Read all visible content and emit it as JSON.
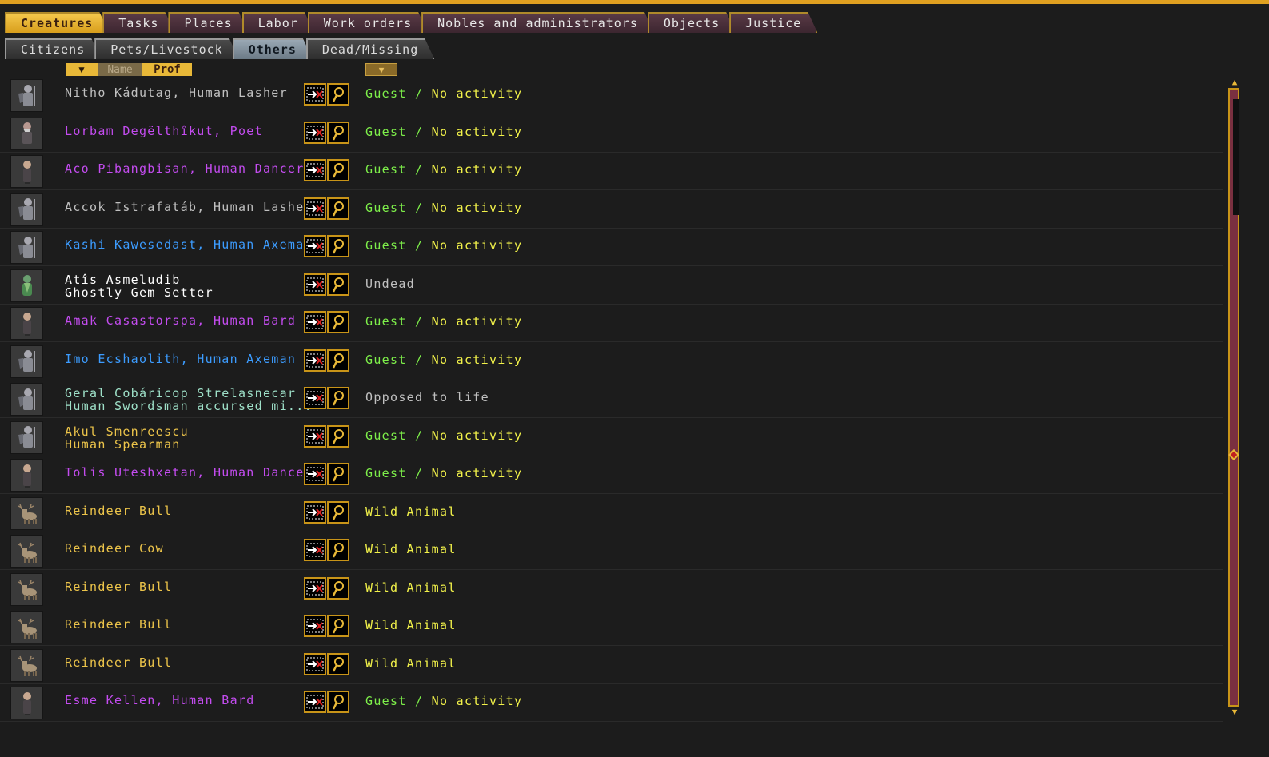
{
  "main_tabs": [
    "Creatures",
    "Tasks",
    "Places",
    "Labor",
    "Work orders",
    "Nobles and administrators",
    "Objects",
    "Justice"
  ],
  "sub_tabs": [
    "Citizens",
    "Pets/Livestock",
    "Others",
    "Dead/Missing"
  ],
  "sort": {
    "name_label": "Name",
    "prof_label": "Prof",
    "dropdown_glyph": "▼"
  },
  "colors": {
    "guest": "#7ef04a",
    "activity": "#f2f24a",
    "grey": "#c0c0c0",
    "magenta": "#c44cf0",
    "blue": "#3c9cff",
    "yellow": "#ecc44a",
    "white": "#ffffff",
    "teal": "#9ee0c8"
  },
  "rows": [
    {
      "name": "Nitho Kádutag, Human Lasher",
      "color": "grey",
      "icon": "armored-human-portrait",
      "status1": "Guest",
      "status2": "No activity",
      "scolor": "guest"
    },
    {
      "name": "Lorbam Degëlthîkut, Poet",
      "color": "magenta",
      "icon": "dwarf-portrait",
      "status1": "Guest",
      "status2": "No activity",
      "scolor": "guest"
    },
    {
      "name": "Aco Pibangbisan, Human Dancer",
      "color": "magenta",
      "icon": "human-portrait",
      "status1": "Guest",
      "status2": "No activity",
      "scolor": "guest"
    },
    {
      "name": "Accok Istrafatáb, Human Lasher",
      "color": "grey",
      "icon": "armored-human-portrait",
      "status1": "Guest",
      "status2": "No activity",
      "scolor": "guest"
    },
    {
      "name": "Kashi Kawesedast, Human Axeman",
      "color": "blue",
      "icon": "armored-human-portrait",
      "status1": "Guest",
      "status2": "No activity",
      "scolor": "guest"
    },
    {
      "name": "Atîs Asmeludib\nGhostly Gem Setter",
      "color": "white",
      "icon": "ghost-dwarf-portrait",
      "status1": "Undead",
      "status2": "",
      "scolor": "grey"
    },
    {
      "name": "Amak Casastorspa, Human Bard",
      "color": "magenta",
      "icon": "human-portrait",
      "status1": "Guest",
      "status2": "No activity",
      "scolor": "guest"
    },
    {
      "name": "Imo Ecshaolith, Human Axeman",
      "color": "blue",
      "icon": "armored-human-portrait",
      "status1": "Guest",
      "status2": "No activity",
      "scolor": "guest"
    },
    {
      "name": "Geral Cobáricop Strelasnecar\nHuman Swordsman accursed mi...",
      "color": "teal",
      "icon": "armored-human-portrait",
      "status1": "Opposed to life",
      "status2": "",
      "scolor": "grey"
    },
    {
      "name": "Akul Smenreescu\nHuman Spearman",
      "color": "yellow",
      "icon": "armored-human-portrait",
      "status1": "Guest",
      "status2": "No activity",
      "scolor": "guest"
    },
    {
      "name": "Tolis Uteshxetan, Human Dancer",
      "color": "magenta",
      "icon": "human-portrait",
      "status1": "Guest",
      "status2": "No activity",
      "scolor": "guest"
    },
    {
      "name": "Reindeer Bull",
      "color": "yellow",
      "icon": "reindeer-portrait",
      "status1": "Wild Animal",
      "status2": "",
      "scolor": "activity"
    },
    {
      "name": "Reindeer Cow",
      "color": "yellow",
      "icon": "reindeer-portrait",
      "status1": "Wild Animal",
      "status2": "",
      "scolor": "activity"
    },
    {
      "name": "Reindeer Bull",
      "color": "yellow",
      "icon": "reindeer-portrait",
      "status1": "Wild Animal",
      "status2": "",
      "scolor": "activity"
    },
    {
      "name": "Reindeer Bull",
      "color": "yellow",
      "icon": "reindeer-portrait",
      "status1": "Wild Animal",
      "status2": "",
      "scolor": "activity"
    },
    {
      "name": "Reindeer Bull",
      "color": "yellow",
      "icon": "reindeer-portrait",
      "status1": "Wild Animal",
      "status2": "",
      "scolor": "activity"
    },
    {
      "name": "Esme Kellen, Human Bard",
      "color": "magenta",
      "icon": "human-portrait",
      "status1": "Guest",
      "status2": "No activity",
      "scolor": "guest"
    }
  ],
  "row_buttons": {
    "zoom_icon": "zoom-to-creature-icon",
    "view_icon": "view-details-icon"
  },
  "status_separator": " / ",
  "scrollbar": {
    "position": "top"
  }
}
